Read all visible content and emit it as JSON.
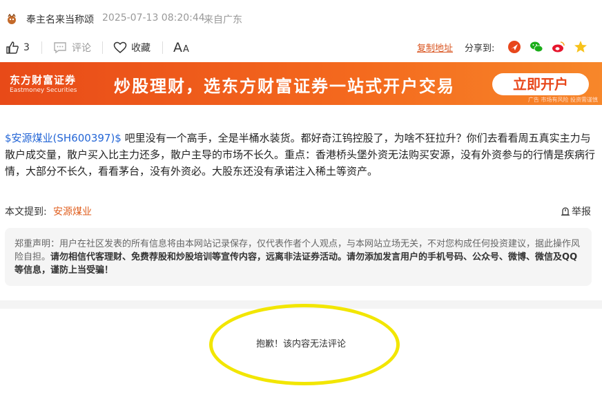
{
  "post": {
    "author": "奉主名来当称颂",
    "time": "2025-07-13 08:20:44",
    "location": "来自广东",
    "stock_tag": "$安源煤业(SH600397)$",
    "body": " 吧里没有一个高手，全是半桶水装货。都好奇江钨控股了，为啥不狂拉升？你们去看看周五真实主力与散户成交量，散户买入比主力还多，散户主导的市场不长久。重点：香港桥头堡外资无法购买安源，没有外资参与的行情是疾病行情，大部分不长久，看看茅台，没有外资必。大股东还没有承诺注入稀土等资产。"
  },
  "actions": {
    "like_count": "3",
    "comment_label": "评论",
    "favorite_label": "收藏",
    "font_label_big": "A",
    "font_label_small": "A",
    "copy_link": "复制地址",
    "share_label": "分享到:"
  },
  "banner": {
    "logo_cn": "东方财富证券",
    "logo_en": "Eastmoney Securities",
    "slogan": "炒股理财，选东方财富证券一站式开户交易",
    "button": "立即开户",
    "note": "广告 市场有风险 投资需谨慎"
  },
  "mention": {
    "label": "本文提到:",
    "stock": "安源煤业"
  },
  "report_label": "举报",
  "disclaimer": {
    "normal": "郑重声明：用户在社区发表的所有信息将由本网站记录保存，仅代表作者个人观点，与本网站立场无关，不对您构成任何投资建议，据此操作风险自担。",
    "bold": "请勿相信代客理财、免费荐股和炒股培训等宣传内容，远离非法证券活动。请勿添加发言用户的手机号码、公众号、微博、微信及QQ等信息，谨防上当受骗！"
  },
  "no_comment": "抱歉！该内容无法评论",
  "colors": {
    "brand_orange": "#e84a18",
    "link_blue": "#2466d6",
    "highlight_yellow": "#f2e600"
  }
}
